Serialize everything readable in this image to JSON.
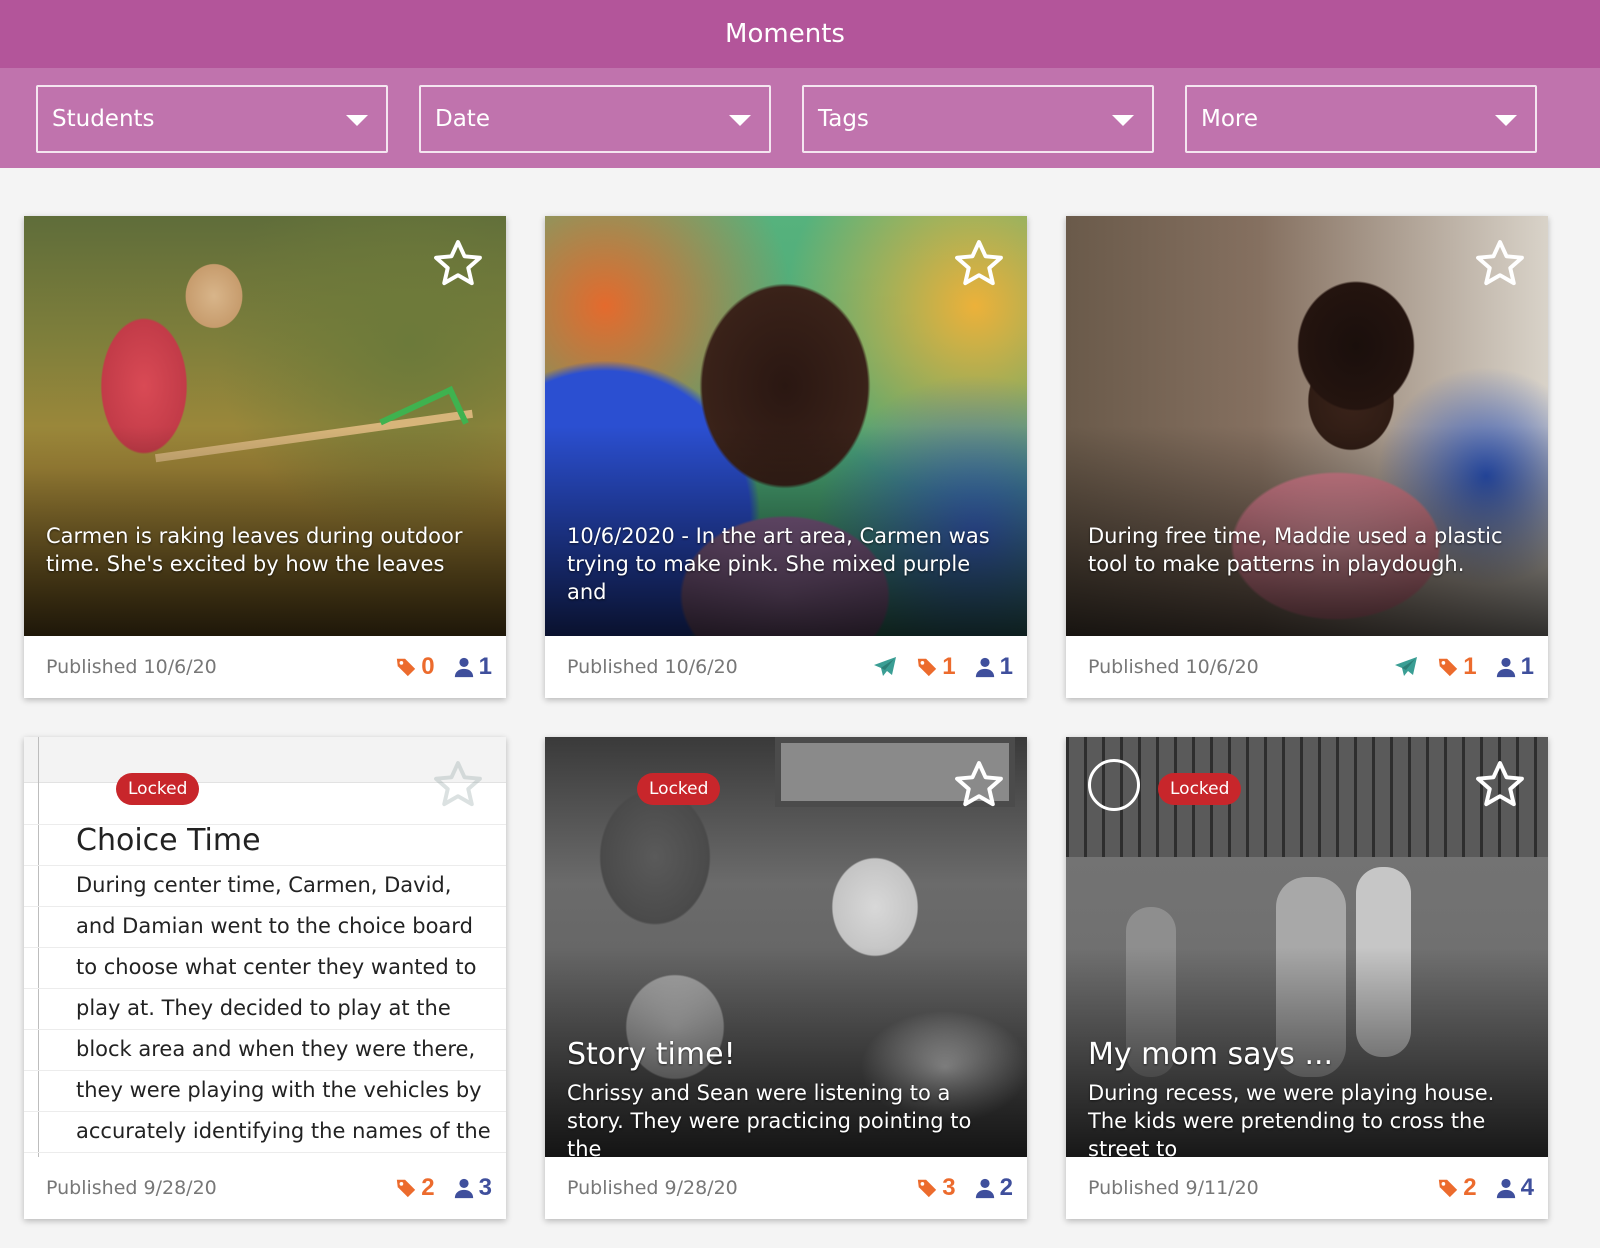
{
  "header": {
    "title": "Moments"
  },
  "filters": [
    {
      "label": "Students"
    },
    {
      "label": "Date"
    },
    {
      "label": "Tags"
    },
    {
      "label": "More"
    }
  ],
  "cards": [
    {
      "caption": "Carmen is raking leaves during outdoor time. She's excited by how the leaves",
      "published": "Published 10/6/20",
      "tags": "0",
      "people": "1"
    },
    {
      "caption": "10/6/2020 - In the art area, Carmen was trying to make pink. She mixed purple and",
      "published": "Published 10/6/20",
      "tags": "1",
      "people": "1"
    },
    {
      "caption": "During free time, Maddie used a plastic tool to make patterns in playdough.",
      "published": "Published 10/6/20",
      "tags": "1",
      "people": "1"
    },
    {
      "locked": "Locked",
      "title": "Choice Time",
      "body": "During center time, Carmen, David, and Damian went to the choice board to choose what center they wanted to play at. They decided to play at the block area and when they were there, they were playing with the vehicles by accurately identifying the names of the",
      "published": "Published 9/28/20",
      "tags": "2",
      "people": "3"
    },
    {
      "locked": "Locked",
      "title": "Story time!",
      "caption": "Chrissy and Sean were listening to a story. They were practicing pointing to the",
      "published": "Published 9/28/20",
      "tags": "3",
      "people": "2"
    },
    {
      "locked": "Locked",
      "title": "My mom says ...",
      "caption": "During recess, we were playing house. The kids were pretending to cross the street to",
      "published": "Published 9/11/20",
      "tags": "2",
      "people": "4"
    }
  ],
  "colors": {
    "header": "#b3559a",
    "filterbar": "#c073ad",
    "tag": "#ec6b2d",
    "people": "#3f4f9c",
    "send": "#3a9e94",
    "locked": "#c8262b"
  },
  "icons": {
    "star": "star-outline-icon",
    "tag": "tag-icon",
    "people": "person-icon",
    "send": "paper-plane-icon",
    "dropdown": "caret-down-icon"
  }
}
